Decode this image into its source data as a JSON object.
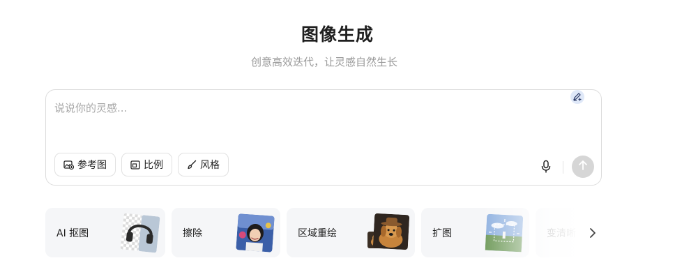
{
  "header": {
    "title": "图像生成",
    "subtitle": "创意高效迭代，让灵感自然生长"
  },
  "prompt": {
    "value": "",
    "placeholder": "说说你的灵感..."
  },
  "tools": {
    "reference_label": "参考图",
    "ratio_label": "比例",
    "style_label": "风格"
  },
  "icons": {
    "pen": "pen-plus-icon",
    "reference": "image-plus-icon",
    "ratio": "aspect-ratio-icon",
    "style": "brush-icon",
    "mic": "microphone-icon",
    "send": "arrow-up-icon",
    "next": "chevron-right-icon"
  },
  "cards": [
    {
      "label": "AI 抠图"
    },
    {
      "label": "擦除"
    },
    {
      "label": "区域重绘"
    },
    {
      "label": "扩图"
    },
    {
      "label": "变清晰"
    }
  ],
  "colors": {
    "send_disabled": "#d6d6d6",
    "card_bg": "#f5f6f8",
    "pen_bg": "#dfe8f8"
  }
}
